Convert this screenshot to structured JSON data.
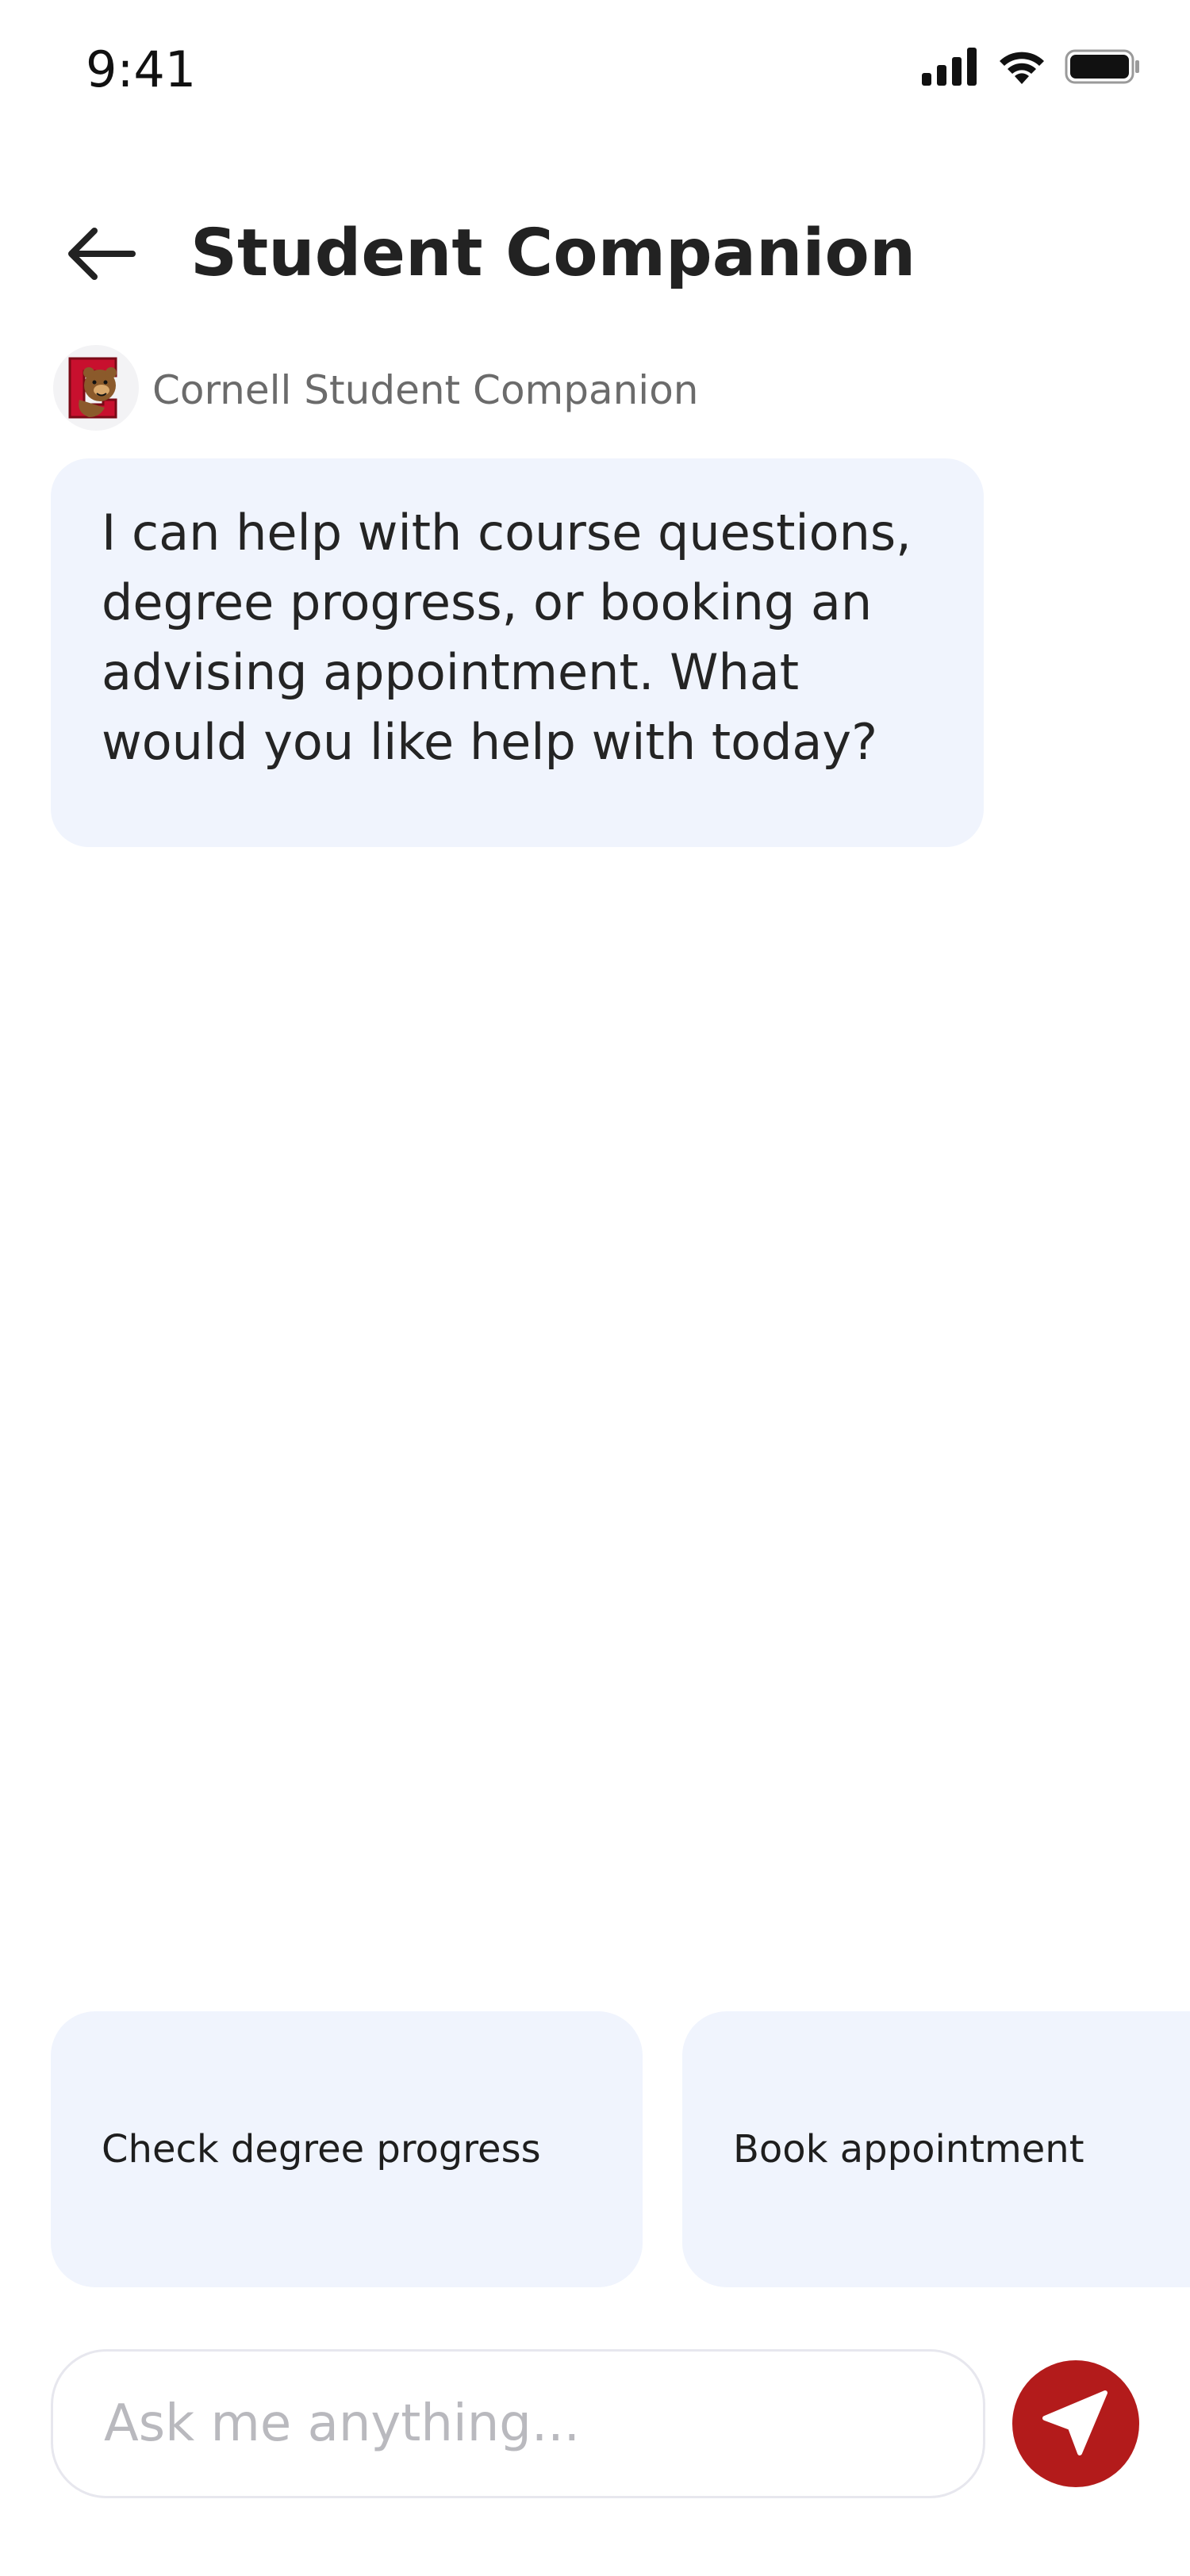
{
  "status_bar": {
    "time": "9:41",
    "icons": [
      "signal-icon",
      "wifi-icon",
      "battery-icon"
    ]
  },
  "header": {
    "title": "Student Companion",
    "back_icon": "arrow-left-icon"
  },
  "bot": {
    "name": "Cornell Student Companion",
    "avatar_icon": "cornell-bear-logo-icon"
  },
  "messages": [
    {
      "sender": "bot",
      "text": "I can help with course questions, degree progress, or booking an advising appointment. What would you like help with today?"
    }
  ],
  "suggestions": [
    {
      "label": "Check degree progress"
    },
    {
      "label": "Book appointment"
    }
  ],
  "composer": {
    "placeholder": "Ask me anything...",
    "value": "",
    "send_icon": "send-paper-plane-icon"
  },
  "colors": {
    "accent": "#b31b1b",
    "bubble_bg": "#f0f4fd",
    "chip_bg": "#f0f4fd",
    "text_primary": "#222222",
    "text_secondary": "#6b6b6b",
    "placeholder": "#b9b9be"
  }
}
